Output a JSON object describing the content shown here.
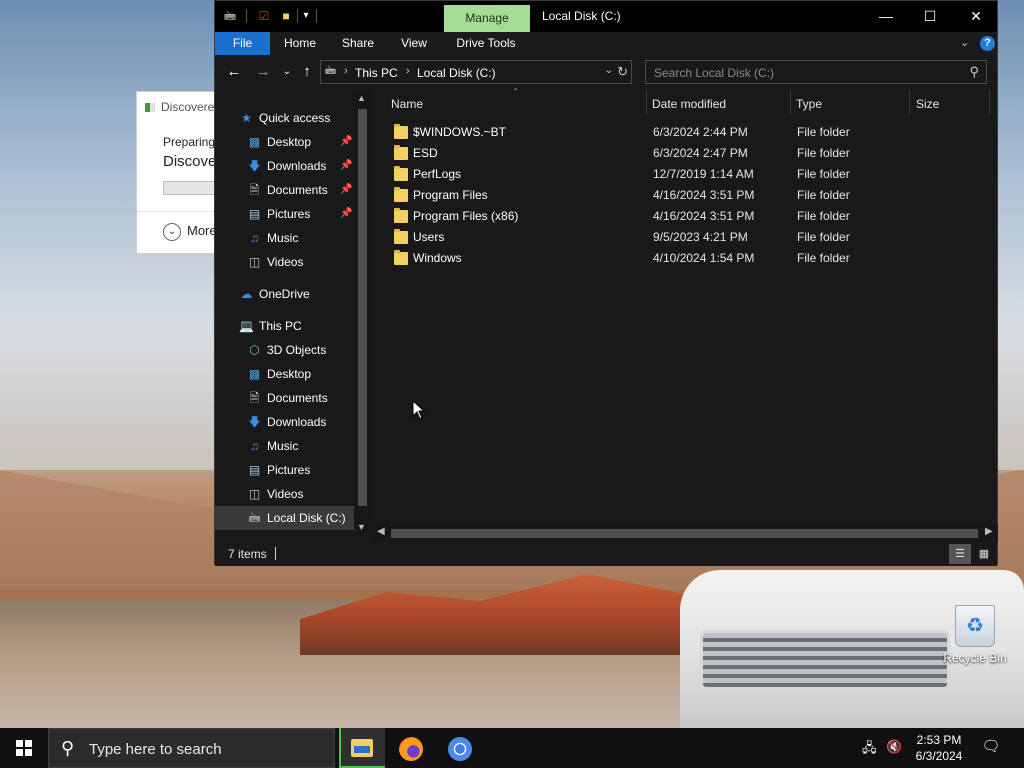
{
  "desktop": {
    "recycle_bin_label": "Recycle Bin"
  },
  "background_dialog": {
    "title": "Discovere",
    "preparing": "Preparing",
    "heading": "Discove",
    "more": "More"
  },
  "explorer": {
    "window_title": "Local Disk (C:)",
    "manage_tab": "Manage",
    "ribbon_tabs": [
      "File",
      "Home",
      "Share",
      "View",
      "Drive Tools"
    ],
    "address_segments": [
      "This PC",
      "Local Disk (C:)"
    ],
    "search_placeholder": "Search Local Disk (C:)",
    "nav": {
      "quick_access": "Quick access",
      "quick_items": [
        "Desktop",
        "Downloads",
        "Documents",
        "Pictures",
        "Music",
        "Videos"
      ],
      "onedrive": "OneDrive",
      "this_pc": "This PC",
      "pc_items": [
        "3D Objects",
        "Desktop",
        "Documents",
        "Downloads",
        "Music",
        "Pictures",
        "Videos",
        "Local Disk (C:)"
      ]
    },
    "columns": [
      "Name",
      "Date modified",
      "Type",
      "Size"
    ],
    "files": [
      {
        "name": "$WINDOWS.~BT",
        "date": "6/3/2024 2:44 PM",
        "type": "File folder"
      },
      {
        "name": "ESD",
        "date": "6/3/2024 2:47 PM",
        "type": "File folder"
      },
      {
        "name": "PerfLogs",
        "date": "12/7/2019 1:14 AM",
        "type": "File folder"
      },
      {
        "name": "Program Files",
        "date": "4/16/2024 3:51 PM",
        "type": "File folder"
      },
      {
        "name": "Program Files (x86)",
        "date": "4/16/2024 3:51 PM",
        "type": "File folder"
      },
      {
        "name": "Users",
        "date": "9/5/2023 4:21 PM",
        "type": "File folder"
      },
      {
        "name": "Windows",
        "date": "4/10/2024 1:54 PM",
        "type": "File folder"
      }
    ],
    "status_count": "7 items"
  },
  "taskbar": {
    "search_placeholder": "Type here to search",
    "time": "2:53 PM",
    "date": "6/3/2024"
  },
  "colors": {
    "accent_file_tab": "#1a6fcf",
    "manage_tab": "#a5dc94",
    "folder": "#f4cf62",
    "taskbar_active": "#4fc24f"
  }
}
